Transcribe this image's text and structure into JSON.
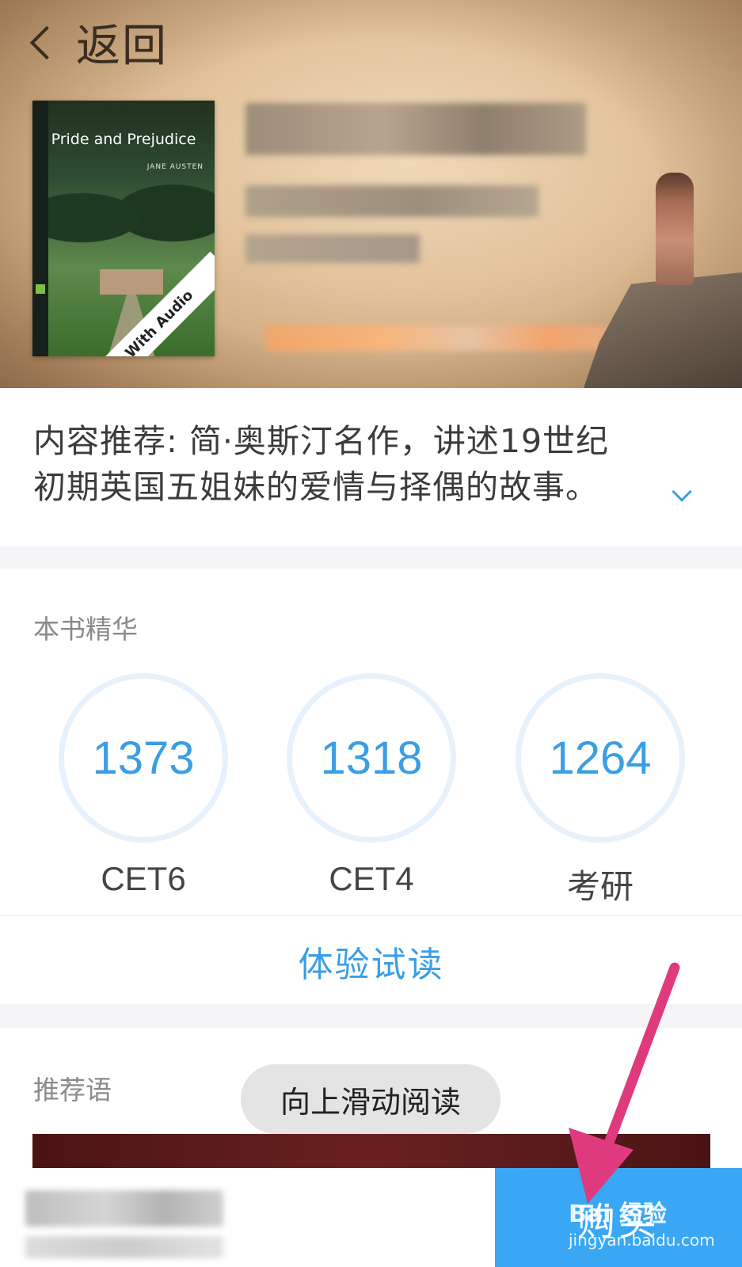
{
  "header": {
    "back_label": "返回",
    "cover": {
      "title": "Pride and Prejudice",
      "author": "JANE AUSTEN",
      "ribbon": "With Audio"
    }
  },
  "description": {
    "line1": "内容推荐: 简·奥斯汀名作，讲述19世纪",
    "line2": "初期英国五姐妹的爱情与择偶的故事。",
    "expand_icon": "chevron-down-icon"
  },
  "essence": {
    "title": "本书精华",
    "stats": [
      {
        "value": "1373",
        "label": "CET6"
      },
      {
        "value": "1318",
        "label": "CET4"
      },
      {
        "value": "1264",
        "label": "考研"
      }
    ],
    "trial_label": "体验试读"
  },
  "recommend": {
    "title": "推荐语"
  },
  "toast": {
    "text": "向上滑动阅读"
  },
  "bottom_bar": {
    "buy_label": "购买"
  },
  "watermark": {
    "brand": "Bai 经验",
    "url": "jingyan.baidu.com"
  },
  "colors": {
    "accent": "#3a9ee4",
    "buy_button": "#3aa7f4",
    "annotation_arrow": "#e03a7e"
  }
}
